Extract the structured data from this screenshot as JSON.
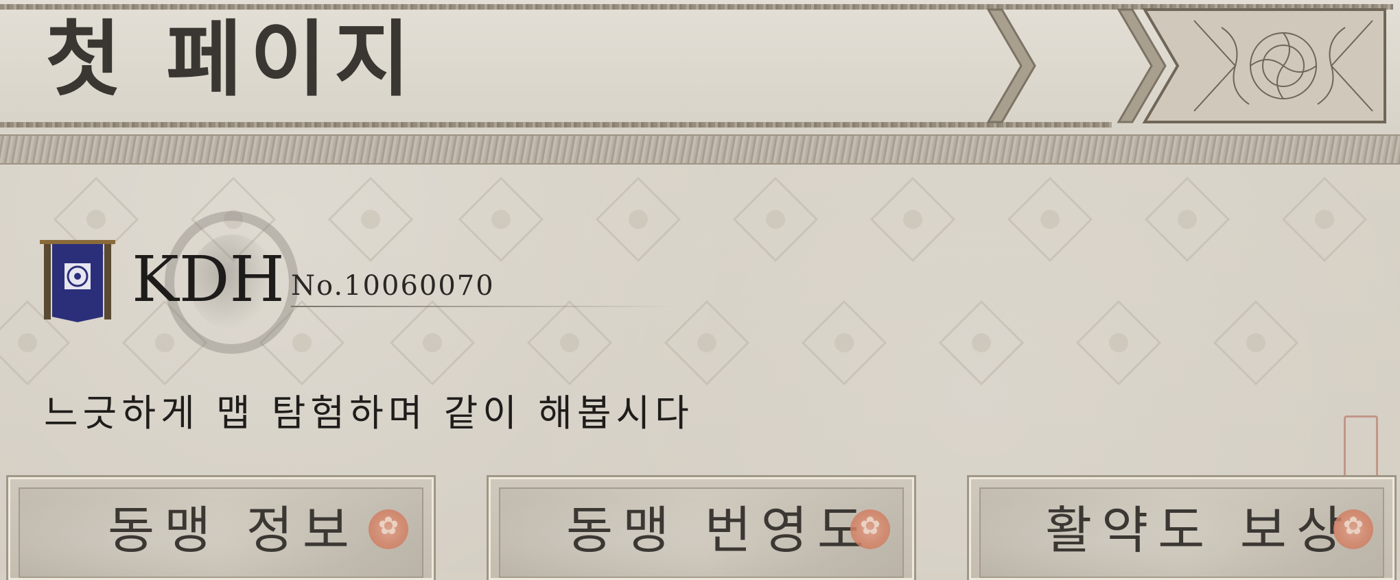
{
  "header": {
    "title": "첫 페이지"
  },
  "profile": {
    "name": "KDH",
    "id_label": "No.10060070",
    "motto": "느긋하게 맵 탐험하며 같이 해봅시다"
  },
  "tabs": [
    {
      "label": "동맹 정보"
    },
    {
      "label": "동맹 번영도"
    },
    {
      "label": "활약도 보상"
    }
  ],
  "colors": {
    "banner_blue": "#2b2f7a",
    "seal_red": "#d48468",
    "ink": "#1e1c1a"
  },
  "icons": {
    "flag": "alliance-flag-icon",
    "tab_seal": "red-seal-icon"
  }
}
